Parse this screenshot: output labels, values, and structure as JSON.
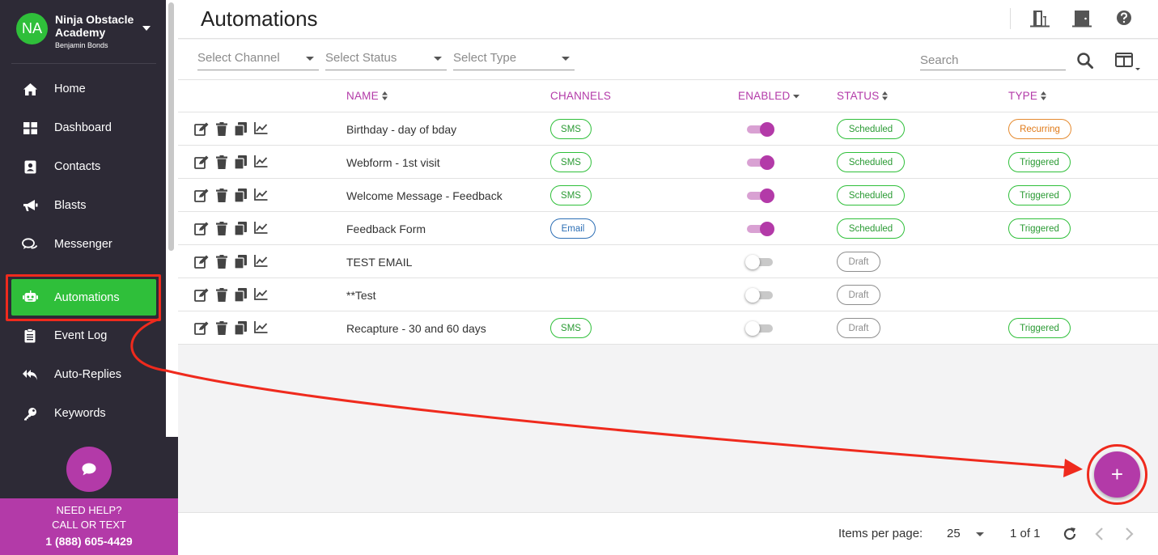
{
  "org": {
    "initials": "NA",
    "name": "Ninja Obstacle Academy",
    "user": "Benjamin Bonds"
  },
  "nav": {
    "home": "Home",
    "dashboard": "Dashboard",
    "contacts": "Contacts",
    "blasts": "Blasts",
    "messenger": "Messenger",
    "automations": "Automations",
    "event_log": "Event Log",
    "auto_replies": "Auto-Replies",
    "keywords": "Keywords"
  },
  "help": {
    "line1": "NEED HELP?",
    "line2": "CALL OR TEXT",
    "phone": "1 (888) 605-4429"
  },
  "page": {
    "title": "Automations"
  },
  "filters": {
    "channel": "Select Channel",
    "status": "Select Status",
    "type": "Select Type",
    "search_placeholder": "Search"
  },
  "columns": {
    "name": "NAME",
    "channels": "CHANNELS",
    "enabled": "ENABLED",
    "status": "STATUS",
    "type": "TYPE"
  },
  "rows": [
    {
      "name": "Birthday - day of bday",
      "channel": "SMS",
      "enabled": true,
      "status": "Scheduled",
      "type": "Recurring"
    },
    {
      "name": "Webform - 1st visit",
      "channel": "SMS",
      "enabled": true,
      "status": "Scheduled",
      "type": "Triggered"
    },
    {
      "name": "Welcome Message - Feedback",
      "channel": "SMS",
      "enabled": true,
      "status": "Scheduled",
      "type": "Triggered"
    },
    {
      "name": "Feedback Form",
      "channel": "Email",
      "enabled": true,
      "status": "Scheduled",
      "type": "Triggered"
    },
    {
      "name": "TEST EMAIL",
      "channel": "",
      "enabled": false,
      "status": "Draft",
      "type": ""
    },
    {
      "name": "**Test",
      "channel": "",
      "enabled": false,
      "status": "Draft",
      "type": ""
    },
    {
      "name": "Recapture - 30 and 60 days",
      "channel": "SMS",
      "enabled": false,
      "status": "Draft",
      "type": "Triggered"
    }
  ],
  "footer": {
    "items_per_page_label": "Items per page:",
    "items_per_page": "25",
    "range": "1 of 1"
  },
  "fab": {
    "label": "+"
  },
  "colors": {
    "sidebar_bg": "#2d2a36",
    "active_green": "#2fbf3a",
    "accent_purple": "#b33aa8",
    "annotation_red": "#ef2a1d"
  }
}
